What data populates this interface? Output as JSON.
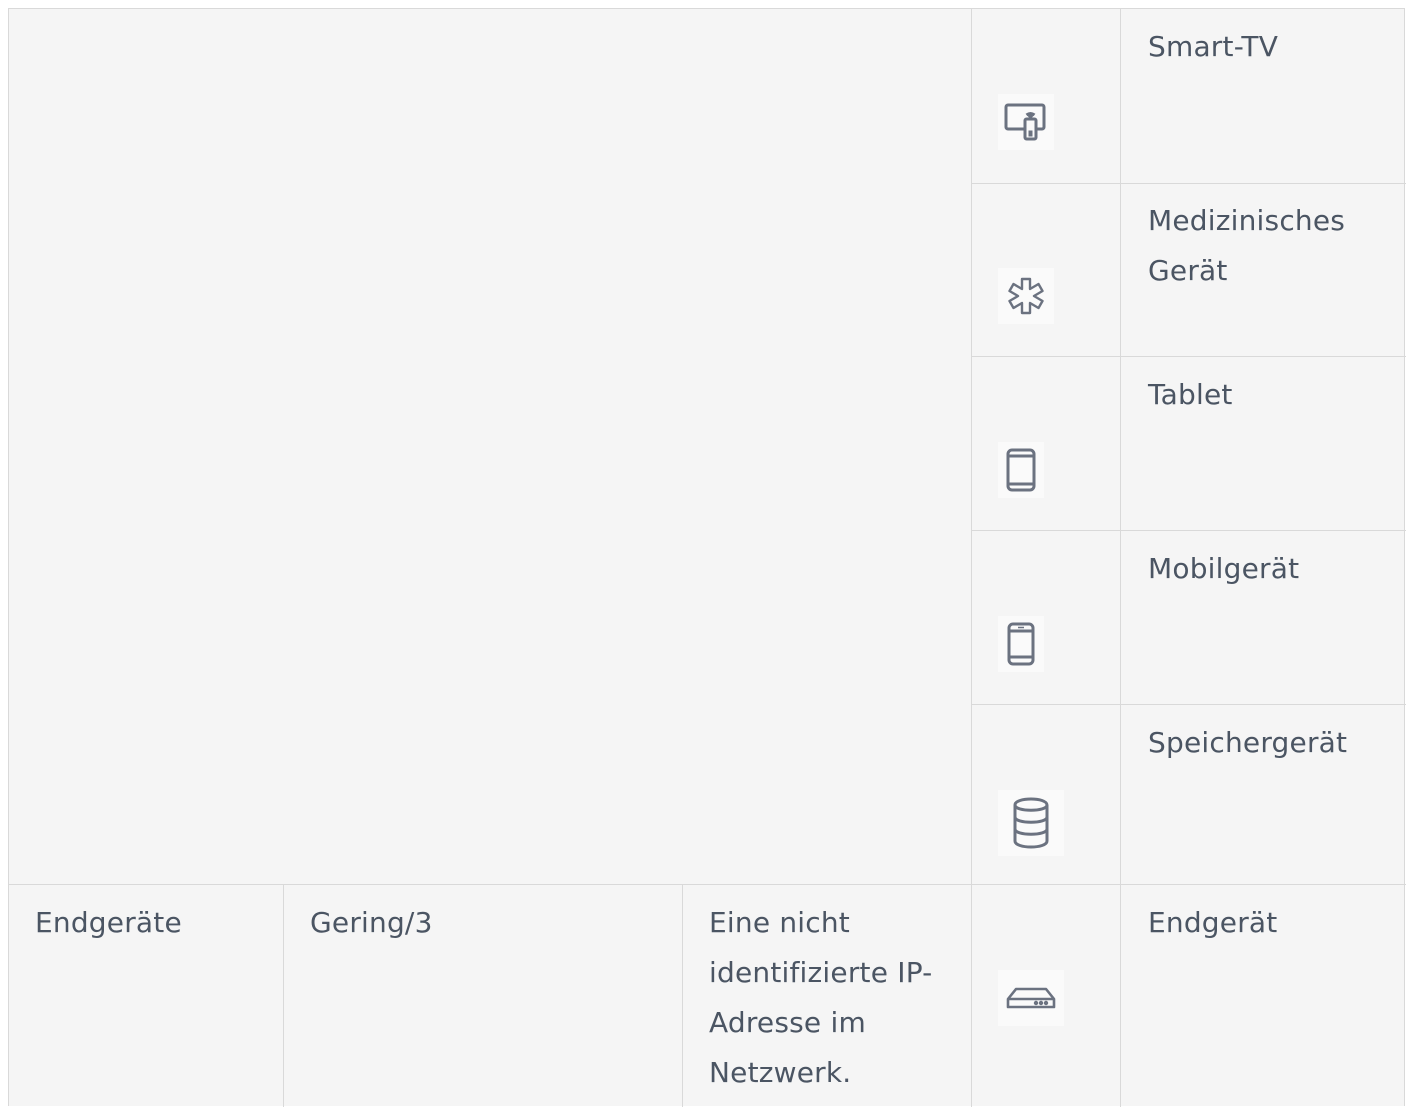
{
  "rows": [
    {
      "type_label": "Smart-TV",
      "icon": "smart-tv-icon"
    },
    {
      "type_label": "Medizinisches Gerät",
      "icon": "medical-device-icon"
    },
    {
      "type_label": "Tablet",
      "icon": "tablet-icon"
    },
    {
      "type_label": "Mobilgerät",
      "icon": "mobile-device-icon"
    },
    {
      "type_label": "Speichergerät",
      "icon": "storage-device-icon"
    }
  ],
  "endpoint_row": {
    "category": "Endgeräte",
    "risk": "Gering/3",
    "description": "Eine nicht identifizierte IP-Adresse im Netzwerk.",
    "icon": "endpoint-device-icon",
    "type_label": "Endgerät"
  },
  "colors": {
    "table_background": "#f5f5f5",
    "border": "#d9d9d9",
    "text": "#4b5563",
    "icon_stroke": "#6b7280"
  }
}
